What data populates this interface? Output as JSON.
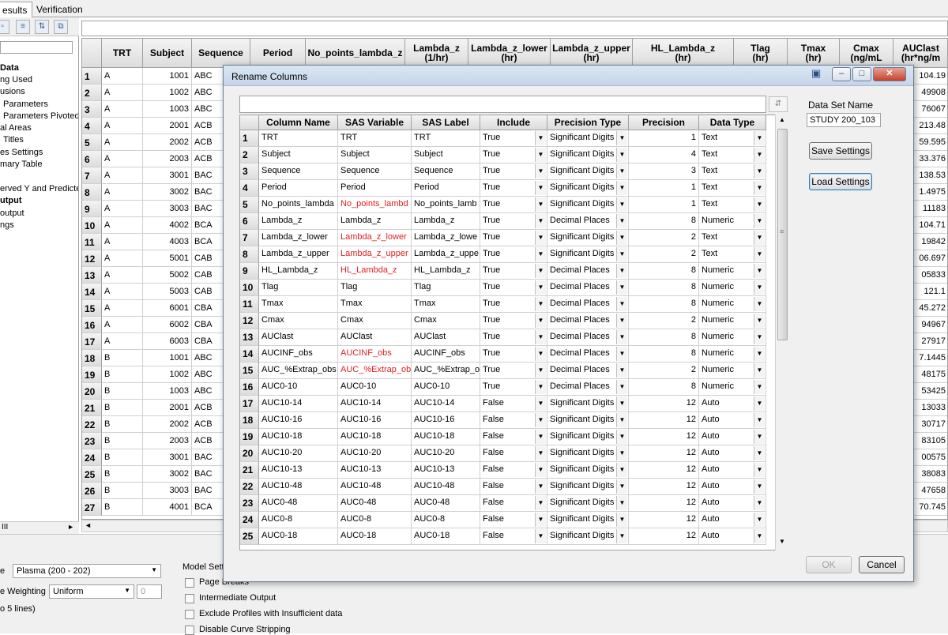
{
  "tabs": [
    "esults",
    "Verification"
  ],
  "sidebar": {
    "items": [
      {
        "label": "Data",
        "bold": true
      },
      {
        "label": "ng Used"
      },
      {
        "label": "usions"
      },
      {
        "label": "Parameters"
      },
      {
        "label": "Parameters Pivoted"
      },
      {
        "label": "al Areas"
      },
      {
        "label": "Titles"
      },
      {
        "label": "es Settings"
      },
      {
        "label": "mary Table"
      },
      {
        "label": ""
      },
      {
        "label": "erved Y and Predicte"
      },
      {
        "label": "utput",
        "bold": true
      },
      {
        "label": "output"
      },
      {
        "label": "ngs"
      }
    ],
    "hscroll_label": "III"
  },
  "bg_grid": {
    "headers": [
      "TRT",
      "Subject",
      "Sequence",
      "Period",
      "No_points_lambda_z",
      "Lambda_z\n(1/hr)",
      "Lambda_z_lower\n(hr)",
      "Lambda_z_upper\n(hr)",
      "HL_Lambda_z\n(hr)",
      "Tlag\n(hr)",
      "Tmax\n(hr)",
      "Cmax\n(ng/mL",
      "AUClast\n(hr*ng/m"
    ],
    "rows": [
      {
        "n": "1",
        "trt": "A",
        "subject": "1001",
        "seq": "ABC",
        "last": "104.19"
      },
      {
        "n": "2",
        "trt": "A",
        "subject": "1002",
        "seq": "ABC",
        "last": "49908"
      },
      {
        "n": "3",
        "trt": "A",
        "subject": "1003",
        "seq": "ABC",
        "last": "76067"
      },
      {
        "n": "4",
        "trt": "A",
        "subject": "2001",
        "seq": "ACB",
        "last": "213.48"
      },
      {
        "n": "5",
        "trt": "A",
        "subject": "2002",
        "seq": "ACB",
        "last": "59.595"
      },
      {
        "n": "6",
        "trt": "A",
        "subject": "2003",
        "seq": "ACB",
        "last": "33.376"
      },
      {
        "n": "7",
        "trt": "A",
        "subject": "3001",
        "seq": "BAC",
        "last": "138.53"
      },
      {
        "n": "8",
        "trt": "A",
        "subject": "3002",
        "seq": "BAC",
        "last": "1.4975"
      },
      {
        "n": "9",
        "trt": "A",
        "subject": "3003",
        "seq": "BAC",
        "last": "11183"
      },
      {
        "n": "10",
        "trt": "A",
        "subject": "4002",
        "seq": "BCA",
        "last": "104.71"
      },
      {
        "n": "11",
        "trt": "A",
        "subject": "4003",
        "seq": "BCA",
        "last": "19842"
      },
      {
        "n": "12",
        "trt": "A",
        "subject": "5001",
        "seq": "CAB",
        "last": "06.697"
      },
      {
        "n": "13",
        "trt": "A",
        "subject": "5002",
        "seq": "CAB",
        "last": "05833"
      },
      {
        "n": "14",
        "trt": "A",
        "subject": "5003",
        "seq": "CAB",
        "last": "121.1"
      },
      {
        "n": "15",
        "trt": "A",
        "subject": "6001",
        "seq": "CBA",
        "last": "45.272"
      },
      {
        "n": "16",
        "trt": "A",
        "subject": "6002",
        "seq": "CBA",
        "last": "94967"
      },
      {
        "n": "17",
        "trt": "A",
        "subject": "6003",
        "seq": "CBA",
        "last": "27917"
      },
      {
        "n": "18",
        "trt": "B",
        "subject": "1001",
        "seq": "ABC",
        "last": "7.1445"
      },
      {
        "n": "19",
        "trt": "B",
        "subject": "1002",
        "seq": "ABC",
        "last": "48175"
      },
      {
        "n": "20",
        "trt": "B",
        "subject": "1003",
        "seq": "ABC",
        "last": "53425"
      },
      {
        "n": "21",
        "trt": "B",
        "subject": "2001",
        "seq": "ACB",
        "last": "13033"
      },
      {
        "n": "22",
        "trt": "B",
        "subject": "2002",
        "seq": "ACB",
        "last": "30717"
      },
      {
        "n": "23",
        "trt": "B",
        "subject": "2003",
        "seq": "ACB",
        "last": "83105"
      },
      {
        "n": "24",
        "trt": "B",
        "subject": "3001",
        "seq": "BAC",
        "last": "00575"
      },
      {
        "n": "25",
        "trt": "B",
        "subject": "3002",
        "seq": "BAC",
        "last": "38083"
      },
      {
        "n": "26",
        "trt": "B",
        "subject": "3003",
        "seq": "BAC",
        "last": "47658"
      },
      {
        "n": "27",
        "trt": "B",
        "subject": "4001",
        "seq": "BCA",
        "last": "70.745"
      }
    ]
  },
  "bottom": {
    "type_label": "e",
    "type_value": "Plasma (200 - 202)",
    "weighting_label": "e  Weighting",
    "weighting_value": "Uniform",
    "weighting_num": "0",
    "lines_label": "o 5 lines)",
    "model_settings_label": "Model Setti",
    "checks": [
      {
        "label": "Page Breaks"
      },
      {
        "label": "Intermediate Output"
      },
      {
        "label": "Exclude Profiles with Insufficient data"
      },
      {
        "label": "Disable Curve Stripping"
      }
    ]
  },
  "dialog": {
    "title": "Rename Columns",
    "columns": [
      "Column Name",
      "SAS Variable",
      "SAS Label",
      "Include",
      "Precision Type",
      "Precision",
      "Data Type"
    ],
    "rows": [
      {
        "n": "1",
        "name": "TRT",
        "sas": "TRT",
        "label": "TRT",
        "include": "True",
        "ptype": "Significant Digits",
        "prec": "1",
        "dtype": "Text",
        "red": false
      },
      {
        "n": "2",
        "name": "Subject",
        "sas": "Subject",
        "label": "Subject",
        "include": "True",
        "ptype": "Significant Digits",
        "prec": "4",
        "dtype": "Text",
        "red": false
      },
      {
        "n": "3",
        "name": "Sequence",
        "sas": "Sequence",
        "label": "Sequence",
        "include": "True",
        "ptype": "Significant Digits",
        "prec": "3",
        "dtype": "Text",
        "red": false
      },
      {
        "n": "4",
        "name": "Period",
        "sas": "Period",
        "label": "Period",
        "include": "True",
        "ptype": "Significant Digits",
        "prec": "1",
        "dtype": "Text",
        "red": false
      },
      {
        "n": "5",
        "name": "No_points_lambda",
        "sas": "No_points_lambd",
        "label": "No_points_lamb",
        "include": "True",
        "ptype": "Significant Digits",
        "prec": "1",
        "dtype": "Text",
        "red": true
      },
      {
        "n": "6",
        "name": "Lambda_z",
        "sas": "Lambda_z",
        "label": "Lambda_z",
        "include": "True",
        "ptype": "Decimal Places",
        "prec": "8",
        "dtype": "Numeric",
        "red": false
      },
      {
        "n": "7",
        "name": "Lambda_z_lower",
        "sas": "Lambda_z_lower",
        "label": "Lambda_z_lowe",
        "include": "True",
        "ptype": "Significant Digits",
        "prec": "2",
        "dtype": "Text",
        "red": true
      },
      {
        "n": "8",
        "name": "Lambda_z_upper",
        "sas": "Lambda_z_upper",
        "label": "Lambda_z_uppe",
        "include": "True",
        "ptype": "Significant Digits",
        "prec": "2",
        "dtype": "Text",
        "red": true
      },
      {
        "n": "9",
        "name": "HL_Lambda_z",
        "sas": "HL_Lambda_z",
        "label": "HL_Lambda_z",
        "include": "True",
        "ptype": "Decimal Places",
        "prec": "8",
        "dtype": "Numeric",
        "red": true
      },
      {
        "n": "10",
        "name": "Tlag",
        "sas": "Tlag",
        "label": "Tlag",
        "include": "True",
        "ptype": "Decimal Places",
        "prec": "8",
        "dtype": "Numeric",
        "red": false
      },
      {
        "n": "11",
        "name": "Tmax",
        "sas": "Tmax",
        "label": "Tmax",
        "include": "True",
        "ptype": "Decimal Places",
        "prec": "8",
        "dtype": "Numeric",
        "red": false
      },
      {
        "n": "12",
        "name": "Cmax",
        "sas": "Cmax",
        "label": "Cmax",
        "include": "True",
        "ptype": "Decimal Places",
        "prec": "2",
        "dtype": "Numeric",
        "red": false
      },
      {
        "n": "13",
        "name": "AUClast",
        "sas": "AUClast",
        "label": "AUClast",
        "include": "True",
        "ptype": "Decimal Places",
        "prec": "8",
        "dtype": "Numeric",
        "red": false
      },
      {
        "n": "14",
        "name": "AUCINF_obs",
        "sas": "AUCINF_obs",
        "label": "AUCINF_obs",
        "include": "True",
        "ptype": "Decimal Places",
        "prec": "8",
        "dtype": "Numeric",
        "red": true
      },
      {
        "n": "15",
        "name": "AUC_%Extrap_obs",
        "sas": "AUC_%Extrap_ob",
        "label": "AUC_%Extrap_o",
        "include": "True",
        "ptype": "Decimal Places",
        "prec": "2",
        "dtype": "Numeric",
        "red": true
      },
      {
        "n": "16",
        "name": "AUC0-10",
        "sas": "AUC0-10",
        "label": "AUC0-10",
        "include": "True",
        "ptype": "Decimal Places",
        "prec": "8",
        "dtype": "Numeric",
        "red": false
      },
      {
        "n": "17",
        "name": "AUC10-14",
        "sas": "AUC10-14",
        "label": "AUC10-14",
        "include": "False",
        "ptype": "Significant Digits",
        "prec": "12",
        "dtype": "Auto",
        "red": false
      },
      {
        "n": "18",
        "name": "AUC10-16",
        "sas": "AUC10-16",
        "label": "AUC10-16",
        "include": "False",
        "ptype": "Significant Digits",
        "prec": "12",
        "dtype": "Auto",
        "red": false
      },
      {
        "n": "19",
        "name": "AUC10-18",
        "sas": "AUC10-18",
        "label": "AUC10-18",
        "include": "False",
        "ptype": "Significant Digits",
        "prec": "12",
        "dtype": "Auto",
        "red": false
      },
      {
        "n": "20",
        "name": "AUC10-20",
        "sas": "AUC10-20",
        "label": "AUC10-20",
        "include": "False",
        "ptype": "Significant Digits",
        "prec": "12",
        "dtype": "Auto",
        "red": false
      },
      {
        "n": "21",
        "name": "AUC10-13",
        "sas": "AUC10-13",
        "label": "AUC10-13",
        "include": "False",
        "ptype": "Significant Digits",
        "prec": "12",
        "dtype": "Auto",
        "red": false
      },
      {
        "n": "22",
        "name": "AUC10-48",
        "sas": "AUC10-48",
        "label": "AUC10-48",
        "include": "False",
        "ptype": "Significant Digits",
        "prec": "12",
        "dtype": "Auto",
        "red": false
      },
      {
        "n": "23",
        "name": "AUC0-48",
        "sas": "AUC0-48",
        "label": "AUC0-48",
        "include": "False",
        "ptype": "Significant Digits",
        "prec": "12",
        "dtype": "Auto",
        "red": false
      },
      {
        "n": "24",
        "name": "AUC0-8",
        "sas": "AUC0-8",
        "label": "AUC0-8",
        "include": "False",
        "ptype": "Significant Digits",
        "prec": "12",
        "dtype": "Auto",
        "red": false
      },
      {
        "n": "25",
        "name": "AUC0-18",
        "sas": "AUC0-18",
        "label": "AUC0-18",
        "include": "False",
        "ptype": "Significant Digits",
        "prec": "12",
        "dtype": "Auto",
        "red": false
      }
    ],
    "dataset_name_label": "Data Set Name",
    "dataset_name_value": "STUDY 200_103",
    "save_settings": "Save Settings",
    "load_settings": "Load Settings",
    "ok": "OK",
    "cancel": "Cancel"
  },
  "colors": {
    "red_text": "#e02020",
    "title_bar": "#c5d5ea",
    "close_button": "#c7402a"
  }
}
